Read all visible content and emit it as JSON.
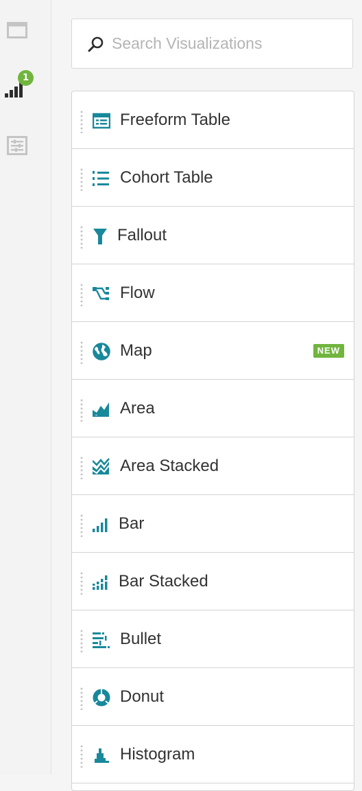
{
  "rail": {
    "items": [
      {
        "name": "panels",
        "icon": "panel-icon"
      },
      {
        "name": "visualizations",
        "icon": "bar-chart-icon",
        "badge": "1"
      },
      {
        "name": "components",
        "icon": "components-icon"
      }
    ],
    "badge_color": "#71b53e"
  },
  "search": {
    "placeholder": "Search Visualizations",
    "value": "",
    "icon": "search-icon"
  },
  "visualizations": [
    {
      "label": "Freeform Table",
      "icon": "freeform-table-icon"
    },
    {
      "label": "Cohort Table",
      "icon": "cohort-table-icon"
    },
    {
      "label": "Fallout",
      "icon": "fallout-icon"
    },
    {
      "label": "Flow",
      "icon": "flow-icon"
    },
    {
      "label": "Map",
      "icon": "map-icon",
      "badge": "NEW"
    },
    {
      "label": "Area",
      "icon": "area-icon"
    },
    {
      "label": "Area Stacked",
      "icon": "area-stacked-icon"
    },
    {
      "label": "Bar",
      "icon": "bar-icon"
    },
    {
      "label": "Bar Stacked",
      "icon": "bar-stacked-icon"
    },
    {
      "label": "Bullet",
      "icon": "bullet-icon"
    },
    {
      "label": "Donut",
      "icon": "donut-icon"
    },
    {
      "label": "Histogram",
      "icon": "histogram-icon"
    }
  ],
  "colors": {
    "accent": "#18889b",
    "new_badge": "#71b53e",
    "rail_icon_active": "#2d2d2d",
    "rail_icon": "#c4c4c4"
  }
}
